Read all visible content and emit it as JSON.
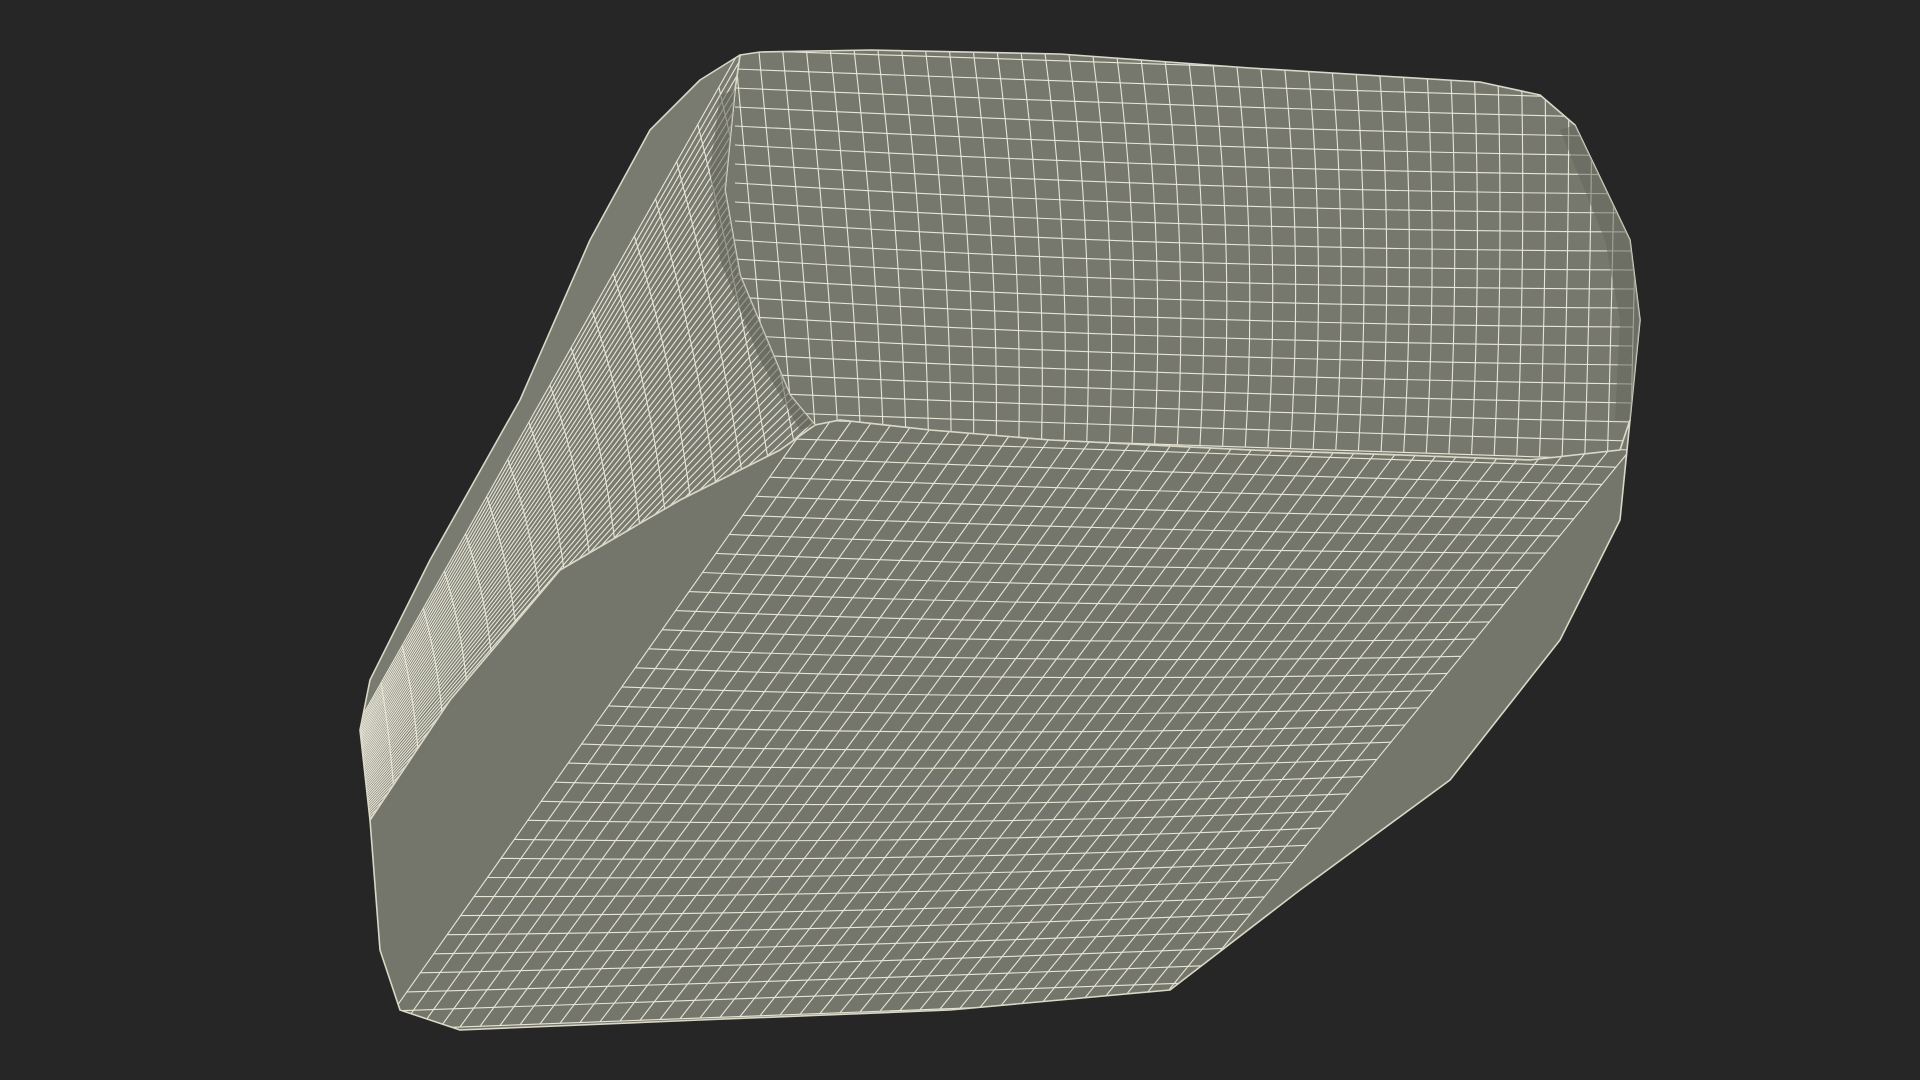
{
  "viewport": {
    "background_color": "#262626",
    "object": {
      "description_icon": "wireframe-mesh-object",
      "fill_color": "#75766b",
      "wire_color": "#f1efe0",
      "outline_color": "#d9d7c6"
    }
  }
}
